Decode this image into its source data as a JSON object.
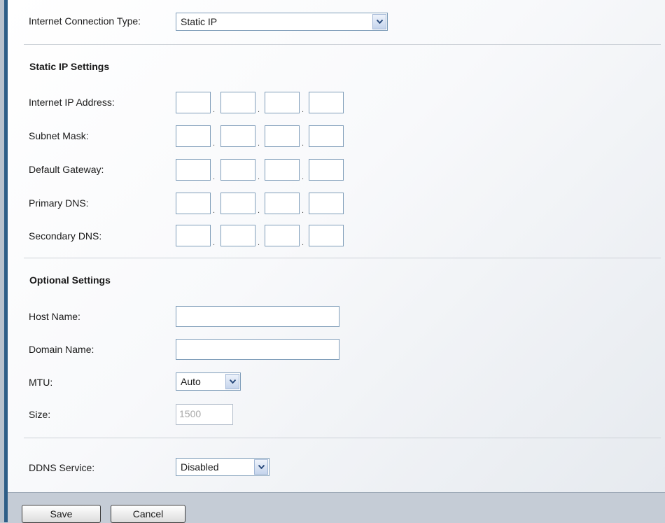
{
  "connection": {
    "label": "Internet Connection Type:",
    "value": "Static IP"
  },
  "static_ip": {
    "header": "Static IP Settings",
    "fields": [
      {
        "label": "Internet IP Address:"
      },
      {
        "label": "Subnet Mask:"
      },
      {
        "label": "Default Gateway:"
      },
      {
        "label": "Primary DNS:"
      },
      {
        "label": "Secondary DNS:"
      }
    ]
  },
  "optional": {
    "header": "Optional Settings",
    "host_name_label": "Host Name:",
    "domain_name_label": "Domain Name:",
    "mtu_label": "MTU:",
    "mtu_value": "Auto",
    "size_label": "Size:",
    "size_value": "1500"
  },
  "ddns": {
    "label": "DDNS Service:",
    "value": "Disabled"
  },
  "buttons": {
    "save": "Save",
    "cancel": "Cancel"
  }
}
